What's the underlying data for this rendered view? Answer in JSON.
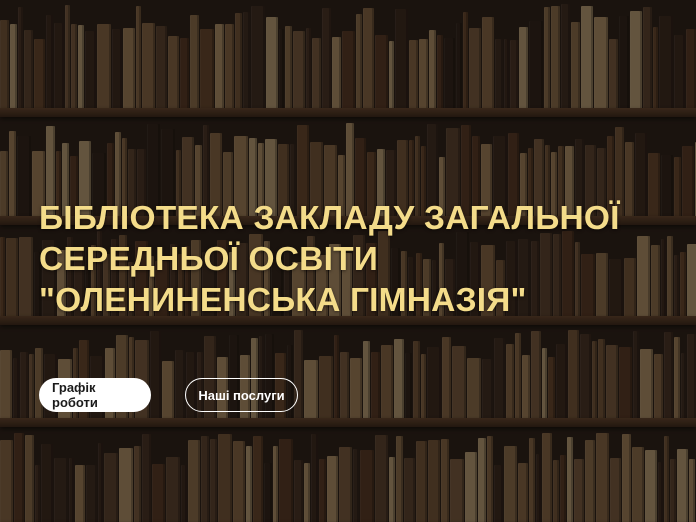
{
  "hero": {
    "title": "БІБЛІОТЕКА ЗАКЛАДУ ЗАГАЛЬНОЇ СЕРЕДНЬОЇ ОСВІТИ \"ОЛЕНИНЕНСЬКА ГІМНАЗІЯ\"",
    "buttons": {
      "schedule_label": "Графік роботи",
      "services_label": "Наші послуги"
    }
  },
  "colors": {
    "title": "#f4dc8a",
    "primary_button_bg": "#ffffff",
    "background": "#2b2018"
  }
}
